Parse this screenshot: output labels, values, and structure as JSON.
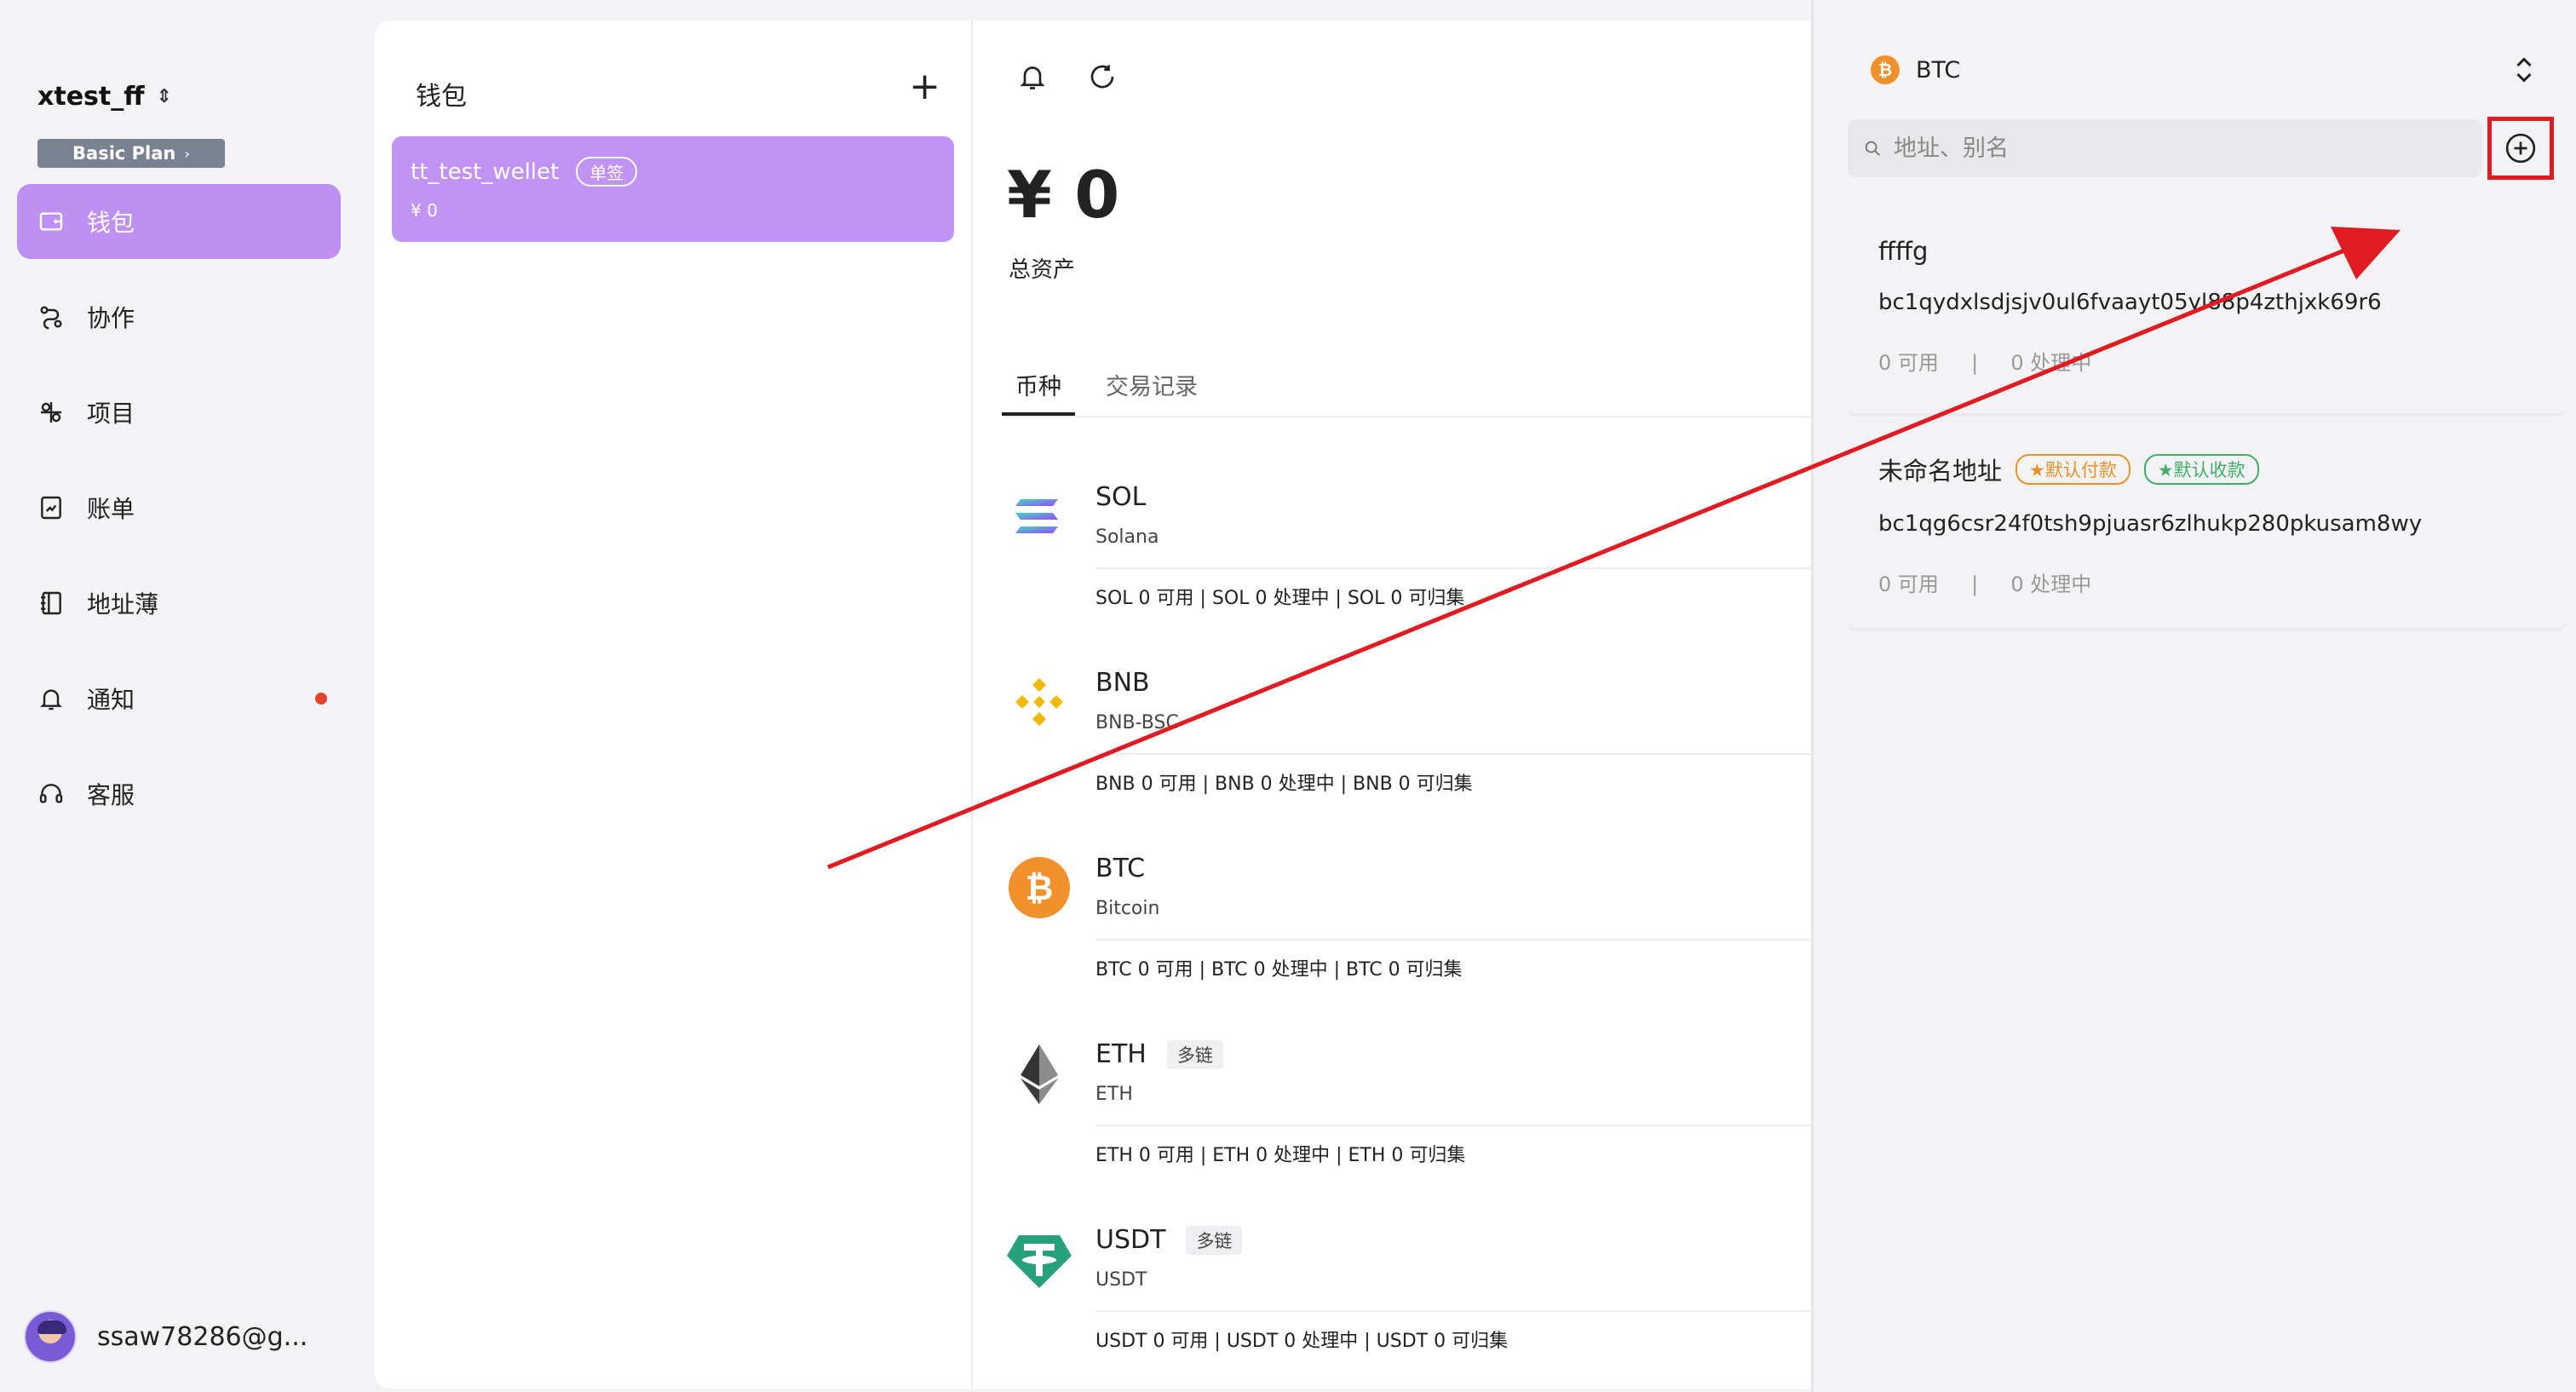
{
  "sidebar": {
    "org_name": "xtest_ff",
    "plan_label": "Basic Plan",
    "nav": [
      {
        "label": "钱包",
        "icon": "wallet-icon",
        "active": true
      },
      {
        "label": "协作",
        "icon": "collaboration-icon"
      },
      {
        "label": "项目",
        "icon": "project-icon"
      },
      {
        "label": "账单",
        "icon": "bill-icon"
      },
      {
        "label": "地址薄",
        "icon": "address-book-icon"
      },
      {
        "label": "通知",
        "icon": "bell-icon",
        "has_dot": true
      },
      {
        "label": "客服",
        "icon": "headset-icon"
      }
    ],
    "user_email": "ssaw78286@g..."
  },
  "wallets": {
    "title": "钱包",
    "add_label": "+",
    "items": [
      {
        "name": "tt_test_wellet",
        "badge": "单签",
        "amount": "¥ 0"
      }
    ]
  },
  "main": {
    "total": "¥ 0",
    "total_label": "总资产",
    "tabs": [
      "币种",
      "交易记录"
    ],
    "active_tab": 0,
    "coins": [
      {
        "symbol": "SOL",
        "chain": "Solana",
        "tag": "",
        "balances": "SOL 0 可用  |  SOL 0 处理中  |  SOL 0 可归集"
      },
      {
        "symbol": "BNB",
        "chain": "BNB-BSC",
        "tag": "",
        "balances": "BNB 0 可用  |  BNB 0 处理中  |  BNB 0 可归集"
      },
      {
        "symbol": "BTC",
        "chain": "Bitcoin",
        "tag": "",
        "balances": "BTC 0 可用  |  BTC 0 处理中  |  BTC 0 可归集"
      },
      {
        "symbol": "ETH",
        "chain": "ETH",
        "tag": "多链",
        "balances": "ETH 0 可用  |  ETH 0 处理中  |  ETH 0 可归集"
      },
      {
        "symbol": "USDT",
        "chain": "USDT",
        "tag": "多链",
        "balances": "USDT 0 可用  |  USDT 0 处理中  |  USDT 0 可归集"
      }
    ]
  },
  "right_panel": {
    "selected_coin": "BTC",
    "search_placeholder": "地址、别名",
    "addresses": [
      {
        "name": "ffffg",
        "tags": [],
        "address": "bc1qydxlsdjsjv0ul6fvaayt05yl88p4zthjxk69r6",
        "available": "0 可用",
        "processing": "0 处理中"
      },
      {
        "name": "未命名地址",
        "tags": [
          "★默认付款",
          "★默认收款"
        ],
        "address": "bc1qg6csr24f0tsh9pjuasr6zlhukp280pkusam8wy",
        "available": "0 可用",
        "processing": "0 处理中"
      }
    ]
  },
  "colors": {
    "accent": "#bf90f3",
    "annotation": "#e11b22",
    "btc": "#f0912c",
    "bnb": "#f0b90b",
    "usdt": "#26a17b"
  }
}
